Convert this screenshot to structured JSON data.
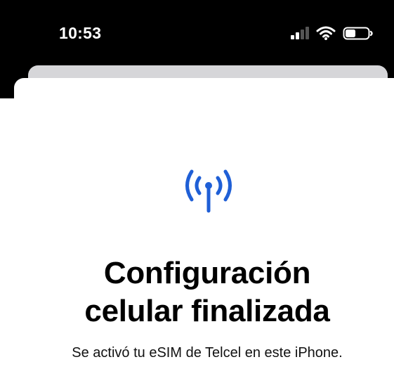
{
  "status_bar": {
    "time": "10:53"
  },
  "icons": {
    "signal": "cellular-signal-icon",
    "wifi": "wifi-icon",
    "battery": "battery-icon",
    "setup": "antenna-radiowaves-icon"
  },
  "colors": {
    "accent": "#1f5fd6",
    "status_bar_bg": "#000000",
    "sheet_bg": "#ffffff",
    "back_sheet": "#d6d6d9"
  },
  "main": {
    "title_line1": "Configuración",
    "title_line2": "celular finalizada",
    "subtitle": "Se activó tu eSIM de Telcel en este iPhone."
  }
}
